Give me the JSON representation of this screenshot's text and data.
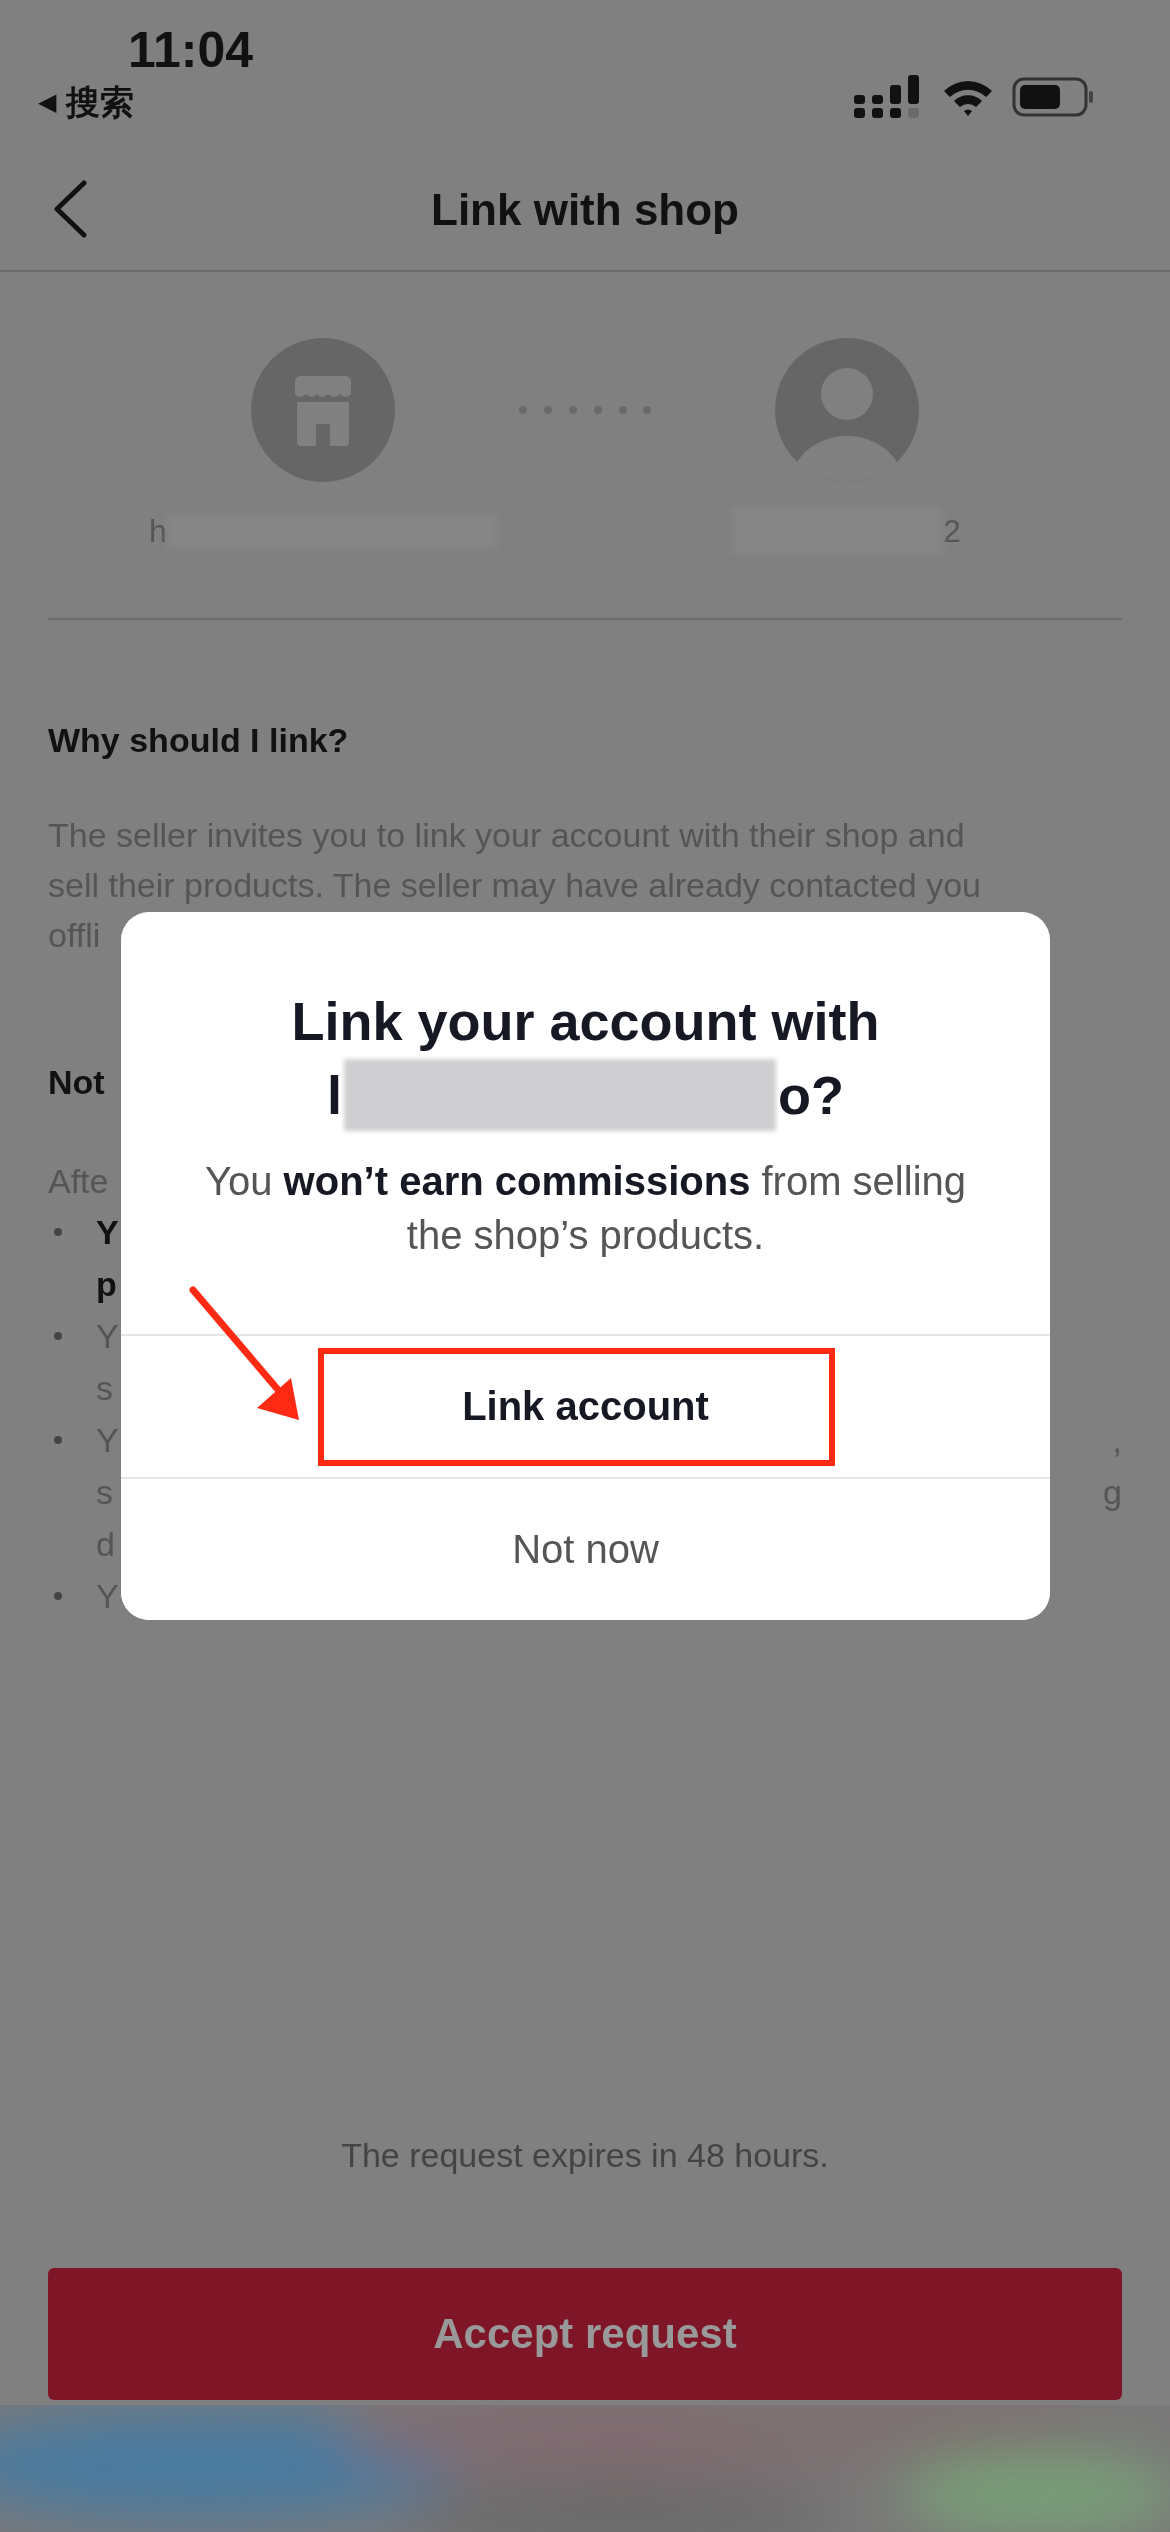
{
  "status_bar": {
    "time": "11:04",
    "back_arrow": "◀",
    "back_app": "搜索"
  },
  "header": {
    "title": "Link with shop"
  },
  "link": {
    "shop_name_start": "h",
    "user_name_end": "2"
  },
  "why": {
    "heading": "Why should I link?",
    "lines": [
      "The seller invites you to link your account with their shop and",
      "sell their products. The seller may have already contacted you",
      "offli"
    ]
  },
  "notes": {
    "heading": "Not",
    "intro": "Afte",
    "bullets": [
      {
        "bold": true,
        "lines": [
          {
            "left": "Y"
          },
          {
            "left": "p"
          }
        ]
      },
      {
        "bold": false,
        "lines": [
          {
            "left": "Y"
          },
          {
            "left": "s"
          }
        ]
      },
      {
        "bold": false,
        "lines": [
          {
            "left": "Y",
            "right": ","
          },
          {
            "left": "s",
            "right": "g"
          },
          {
            "left": "d"
          }
        ]
      },
      {
        "bold": false,
        "lines": [
          {
            "left": "Y"
          }
        ]
      }
    ]
  },
  "dialog": {
    "title": "Link your account with",
    "title_start": "l",
    "title_end": "o?",
    "message": "You **won’t earn commissions** from selling the shop’s products.",
    "actions": [
      {
        "label": "Link account",
        "kind": "primary",
        "highlighted": true
      },
      {
        "label": "Not now",
        "kind": "secondary",
        "highlighted": false
      }
    ]
  },
  "footer": {
    "expiry": "The request expires in 48 hours.",
    "button": "Accept request"
  }
}
